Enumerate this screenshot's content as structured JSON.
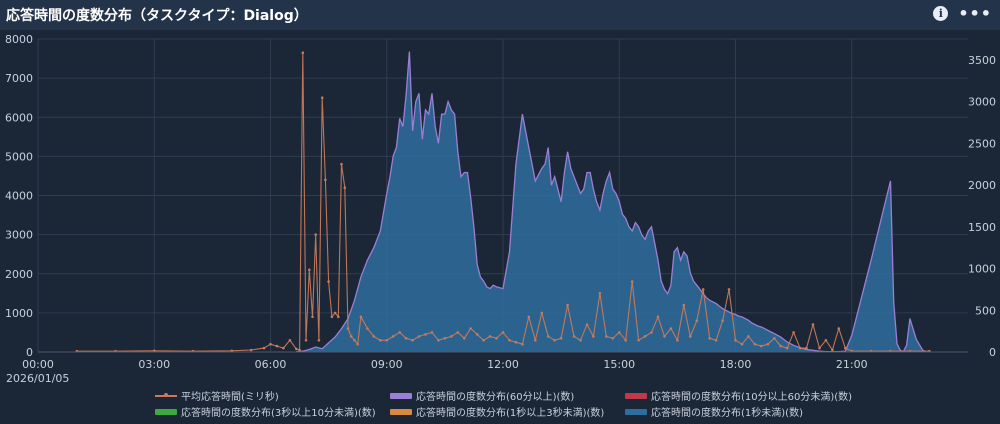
{
  "header": {
    "title": "応答時間の度数分布（タスクタイプ：Dialog）",
    "info_icon": "info-icon",
    "more_icon": "more-options-icon",
    "info_glyph": "i",
    "more_glyph": "•••"
  },
  "colors": {
    "background": "#1b2636",
    "header": "#23344a",
    "grid": "#2f3d50",
    "avg": "#c87a5a",
    "over60": "#9b7fd4",
    "tenTo60": "#c0394b",
    "threeTo10": "#3daa3d",
    "oneTo3": "#d98a3a",
    "under1": "#2e6e9e"
  },
  "chart_data": {
    "type": "area",
    "date_label": "2026/01/05",
    "x_ticks": [
      "00:00",
      "03:00",
      "06:00",
      "09:00",
      "12:00",
      "15:00",
      "18:00",
      "21:00"
    ],
    "x_range_minutes": [
      0,
      1440
    ],
    "y_left_ticks": [
      "0",
      "1000",
      "2000",
      "3000",
      "4000",
      "5000",
      "6000",
      "7000",
      "8000"
    ],
    "y_left_lim": [
      0,
      8000
    ],
    "y_right_ticks": [
      "0",
      "500",
      "1000",
      "1500",
      "2000",
      "2500",
      "3000",
      "3500"
    ],
    "y_right_lim": [
      0,
      3750
    ],
    "grid": true,
    "legend_position": "bottom",
    "legend": [
      "平均応答時間(ミリ秒)",
      "応答時間の度数分布(60分以上)(数)",
      "応答時間の度数分布(10分以上60分未満)(数)",
      "応答時間の度数分布(3秒以上10分未満)(数)",
      "応答時間の度数分布(1秒以上3秒未満)(数)",
      "応答時間の度数分布(1秒未満)(数)"
    ],
    "count_series": {
      "name": "応答時間の度数分布(1秒未満)(数)",
      "axis": "right",
      "x": [
        "06:40",
        "06:50",
        "07:00",
        "07:10",
        "07:20",
        "07:30",
        "07:40",
        "07:50",
        "08:00",
        "08:10",
        "08:20",
        "08:30",
        "08:40",
        "08:50",
        "09:00",
        "09:05",
        "09:10",
        "09:15",
        "09:20",
        "09:25",
        "09:30",
        "09:35",
        "09:40",
        "09:45",
        "09:50",
        "09:55",
        "10:00",
        "10:05",
        "10:10",
        "10:15",
        "10:20",
        "10:25",
        "10:30",
        "10:35",
        "10:40",
        "10:45",
        "10:50",
        "10:55",
        "11:00",
        "11:05",
        "11:10",
        "11:15",
        "11:20",
        "11:25",
        "11:30",
        "11:35",
        "11:40",
        "11:45",
        "11:50",
        "12:00",
        "12:10",
        "12:20",
        "12:30",
        "12:40",
        "12:50",
        "13:00",
        "13:05",
        "13:10",
        "13:15",
        "13:20",
        "13:25",
        "13:30",
        "13:35",
        "13:40",
        "13:45",
        "13:50",
        "13:55",
        "14:00",
        "14:05",
        "14:10",
        "14:15",
        "14:20",
        "14:25",
        "14:30",
        "14:35",
        "14:40",
        "14:45",
        "14:50",
        "14:55",
        "15:00",
        "15:05",
        "15:10",
        "15:15",
        "15:20",
        "15:25",
        "15:30",
        "15:35",
        "15:40",
        "15:45",
        "15:50",
        "15:55",
        "16:00",
        "16:05",
        "16:10",
        "16:15",
        "16:20",
        "16:25",
        "16:30",
        "16:35",
        "16:40",
        "16:45",
        "16:50",
        "16:55",
        "17:00",
        "17:05",
        "17:10",
        "17:15",
        "17:20",
        "17:25",
        "17:30",
        "17:35",
        "17:40",
        "17:45",
        "17:50",
        "17:55",
        "18:00",
        "18:05",
        "18:10",
        "18:15",
        "18:20",
        "18:25",
        "18:30",
        "18:35",
        "18:40",
        "18:45",
        "18:50",
        "18:55",
        "19:00",
        "19:05",
        "19:10",
        "19:15",
        "19:20",
        "19:25",
        "19:30",
        "19:40",
        "19:50",
        "20:00",
        "20:10",
        "20:20",
        "20:30",
        "20:40",
        "20:50",
        "21:00",
        "21:30",
        "22:00",
        "22:05",
        "22:10",
        "22:15",
        "22:20",
        "22:25",
        "22:30",
        "22:40",
        "22:50",
        "22:55",
        "23:00",
        "23:05",
        "23:10"
      ],
      "values": [
        5,
        10,
        30,
        60,
        40,
        110,
        180,
        280,
        400,
        620,
        900,
        1100,
        1250,
        1450,
        1900,
        2100,
        2350,
        2450,
        2800,
        2700,
        3080,
        3600,
        2650,
        3000,
        3100,
        2550,
        2900,
        2850,
        3100,
        2700,
        2500,
        2850,
        2850,
        3000,
        2900,
        2850,
        2400,
        2100,
        2150,
        2150,
        1850,
        1500,
        1050,
        900,
        850,
        780,
        760,
        800,
        780,
        760,
        1200,
        2250,
        2850,
        2450,
        2050,
        2200,
        2250,
        2450,
        2000,
        2100,
        1950,
        1800,
        2150,
        2400,
        2200,
        2100,
        2000,
        1900,
        1950,
        2150,
        2150,
        1950,
        1800,
        1700,
        1900,
        2050,
        2150,
        1950,
        1900,
        1800,
        1650,
        1600,
        1500,
        1450,
        1550,
        1500,
        1400,
        1350,
        1450,
        1500,
        1300,
        1100,
        850,
        750,
        700,
        800,
        1200,
        1250,
        1100,
        1200,
        1150,
        950,
        850,
        800,
        750,
        700,
        650,
        620,
        600,
        580,
        550,
        520,
        500,
        480,
        460,
        450,
        430,
        420,
        400,
        380,
        350,
        330,
        310,
        300,
        280,
        260,
        240,
        220,
        200,
        180,
        150,
        120,
        100,
        80,
        50,
        30,
        20,
        10,
        5,
        5,
        5,
        10,
        200,
        1100,
        2050,
        600,
        100,
        20,
        5,
        80,
        400,
        150,
        20,
        5
      ]
    },
    "avg_series": {
      "name": "平均応答時間(ミリ秒)",
      "axis": "left",
      "x": [
        "01:00",
        "02:00",
        "03:00",
        "04:00",
        "05:00",
        "05:30",
        "05:50",
        "06:00",
        "06:10",
        "06:20",
        "06:30",
        "06:40",
        "06:45",
        "06:50",
        "06:55",
        "07:00",
        "07:05",
        "07:10",
        "07:15",
        "07:20",
        "07:25",
        "07:30",
        "07:35",
        "07:40",
        "07:45",
        "07:50",
        "07:55",
        "08:00",
        "08:05",
        "08:10",
        "08:15",
        "08:20",
        "08:30",
        "08:40",
        "08:50",
        "09:00",
        "09:10",
        "09:20",
        "09:30",
        "09:40",
        "09:50",
        "10:00",
        "10:10",
        "10:20",
        "10:30",
        "10:40",
        "10:50",
        "11:00",
        "11:10",
        "11:20",
        "11:30",
        "11:40",
        "11:50",
        "12:00",
        "12:10",
        "12:20",
        "12:30",
        "12:40",
        "12:50",
        "13:00",
        "13:10",
        "13:20",
        "13:30",
        "13:40",
        "13:50",
        "14:00",
        "14:10",
        "14:20",
        "14:30",
        "14:40",
        "14:50",
        "15:00",
        "15:10",
        "15:20",
        "15:30",
        "15:40",
        "15:50",
        "16:00",
        "16:10",
        "16:20",
        "16:30",
        "16:40",
        "16:50",
        "17:00",
        "17:10",
        "17:20",
        "17:30",
        "17:40",
        "17:50",
        "18:00",
        "18:10",
        "18:20",
        "18:30",
        "18:40",
        "18:50",
        "19:00",
        "19:10",
        "19:20",
        "19:30",
        "19:40",
        "19:50",
        "20:00",
        "20:10",
        "20:20",
        "20:30",
        "20:40",
        "20:50",
        "21:00",
        "21:30",
        "22:00",
        "22:30",
        "23:00"
      ],
      "values": [
        20,
        20,
        30,
        20,
        30,
        50,
        100,
        200,
        150,
        100,
        300,
        80,
        50,
        7650,
        300,
        2100,
        900,
        3000,
        300,
        6500,
        4400,
        1800,
        900,
        1000,
        900,
        4800,
        4200,
        600,
        400,
        300,
        200,
        900,
        600,
        400,
        300,
        300,
        400,
        500,
        350,
        300,
        400,
        450,
        500,
        300,
        350,
        400,
        500,
        350,
        600,
        450,
        300,
        400,
        350,
        500,
        300,
        250,
        200,
        900,
        300,
        1000,
        400,
        300,
        350,
        1200,
        400,
        300,
        700,
        400,
        1500,
        400,
        350,
        500,
        300,
        1800,
        300,
        400,
        500,
        900,
        400,
        600,
        300,
        1200,
        400,
        800,
        1600,
        350,
        300,
        800,
        1600,
        300,
        200,
        400,
        200,
        150,
        200,
        350,
        150,
        100,
        500,
        100,
        100,
        700,
        100,
        300,
        50,
        600,
        100,
        20,
        20,
        20,
        20,
        20
      ]
    }
  },
  "legend_items": [
    {
      "key": "avg",
      "label": "平均応答時間(ミリ秒)"
    },
    {
      "key": "over60",
      "label": "応答時間の度数分布(60分以上)(数)"
    },
    {
      "key": "tenTo60",
      "label": "応答時間の度数分布(10分以上60分未満)(数)"
    },
    {
      "key": "threeTo10",
      "label": "応答時間の度数分布(3秒以上10分未満)(数)"
    },
    {
      "key": "oneTo3",
      "label": "応答時間の度数分布(1秒以上3秒未満)(数)"
    },
    {
      "key": "under1",
      "label": "応答時間の度数分布(1秒未満)(数)"
    }
  ]
}
